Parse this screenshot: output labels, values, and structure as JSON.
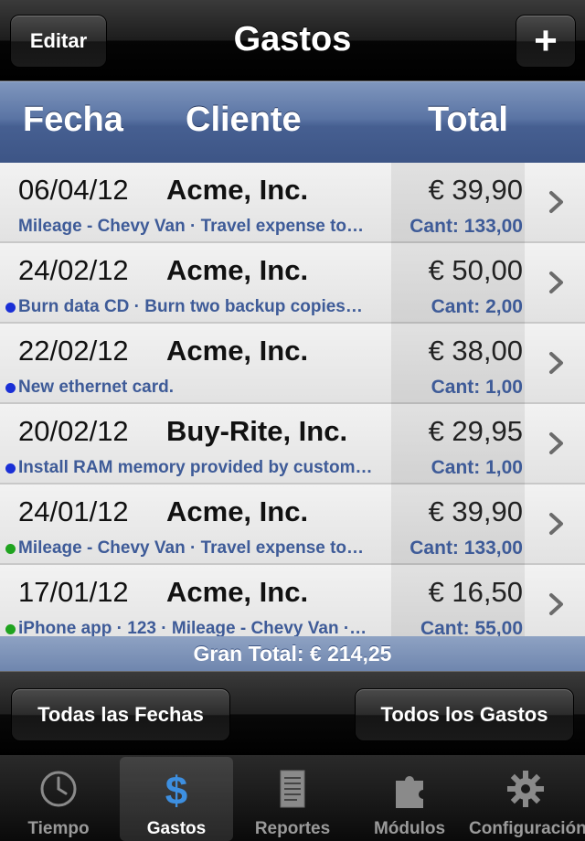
{
  "navbar": {
    "title": "Gastos",
    "edit_label": "Editar",
    "add_label": "+"
  },
  "columns": {
    "date": "Fecha",
    "client": "Cliente",
    "total": "Total"
  },
  "rows": [
    {
      "date": "06/04/12",
      "client": "Acme, Inc.",
      "amount": "€ 39,90",
      "description": "Mileage - Chevy Van · Travel expense to…",
      "quantity": "Cant: 133,00",
      "dot_color": ""
    },
    {
      "date": "24/02/12",
      "client": "Acme, Inc.",
      "amount": "€ 50,00",
      "description": "Burn data CD · Burn two backup copies…",
      "quantity": "Cant: 2,00",
      "dot_color": "#1a2fd6"
    },
    {
      "date": "22/02/12",
      "client": "Acme, Inc.",
      "amount": "€ 38,00",
      "description": "New ethernet card.",
      "quantity": "Cant: 1,00",
      "dot_color": "#1a2fd6"
    },
    {
      "date": "20/02/12",
      "client": "Buy-Rite, Inc.",
      "amount": "€ 29,95",
      "description": "Install RAM memory provided by custom…",
      "quantity": "Cant: 1,00",
      "dot_color": "#1a2fd6"
    },
    {
      "date": "24/01/12",
      "client": "Acme, Inc.",
      "amount": "€ 39,90",
      "description": "Mileage - Chevy Van · Travel expense to…",
      "quantity": "Cant: 133,00",
      "dot_color": "#1fa31f"
    },
    {
      "date": "17/01/12",
      "client": "Acme, Inc.",
      "amount": "€ 16,50",
      "description": "iPhone app · 123 · Mileage - Chevy Van ·…",
      "quantity": "Cant: 55,00",
      "dot_color": "#1fa31f"
    }
  ],
  "grand_total": "Gran Total: € 214,25",
  "toolbar": {
    "dates_label": "Todas las Fechas",
    "expenses_label": "Todos los Gastos"
  },
  "tabs": [
    {
      "label": "Tiempo",
      "icon": "clock-icon",
      "active": false
    },
    {
      "label": "Gastos",
      "icon": "dollar-icon",
      "active": true
    },
    {
      "label": "Reportes",
      "icon": "document-icon",
      "active": false
    },
    {
      "label": "Módulos",
      "icon": "puzzle-icon",
      "active": false
    },
    {
      "label": "Configuración",
      "icon": "gear-icon",
      "active": false
    }
  ],
  "colors": {
    "header_blue": "#465f91",
    "detail_blue": "#3e5b98",
    "active_tab_icon": "#3d8fe0"
  }
}
